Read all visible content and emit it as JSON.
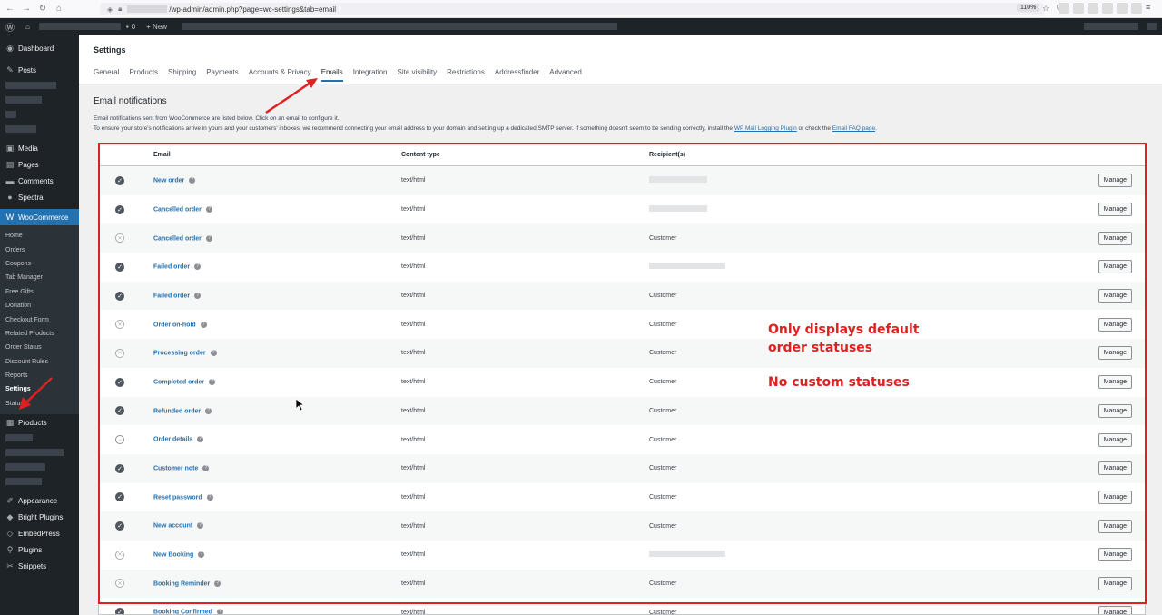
{
  "browser": {
    "url_prefix": "/wp-admin/admin.php?page=wc-settings&tab=email",
    "zoom": "110%"
  },
  "admin_bar": {
    "comments_count": "0",
    "new_label": "+ New"
  },
  "sidebar": {
    "dashboard": "Dashboard",
    "posts": "Posts",
    "media": "Media",
    "pages": "Pages",
    "comments": "Comments",
    "spectra": "Spectra",
    "woocommerce": "WooCommerce",
    "sub": [
      "Home",
      "Orders",
      "Coupons",
      "Tab Manager",
      "Free Gifts",
      "Donation",
      "Checkout Form",
      "Related Products",
      "Order Status",
      "Discount Rules",
      "Reports",
      "Settings",
      "Status"
    ],
    "products": "Products",
    "appearance": "Appearance",
    "bright_plugins": "Bright Plugins",
    "embedpress": "EmbedPress",
    "plugins": "Plugins",
    "snippets": "Snippets"
  },
  "header": {
    "title": "Settings",
    "tabs": [
      "General",
      "Products",
      "Shipping",
      "Payments",
      "Accounts & Privacy",
      "Emails",
      "Integration",
      "Site visibility",
      "Restrictions",
      "Addressfinder",
      "Advanced"
    ],
    "active_tab": "Emails"
  },
  "section": {
    "title": "Email notifications",
    "desc1": "Email notifications sent from WooCommerce are listed below. Click on an email to configure it.",
    "desc2_a": "To ensure your store's notifications arrive in yours and your customers' inboxes, we recommend connecting your email address to your domain and setting up a dedicated SMTP server. If something doesn't seem to be sending correctly, install the ",
    "desc2_link1": "WP Mail Logging Plugin",
    "desc2_b": " or check the ",
    "desc2_link2": "Email FAQ page",
    "desc2_c": "."
  },
  "table": {
    "headers": {
      "email": "Email",
      "content_type": "Content type",
      "recipients": "Recipient(s)"
    },
    "manage_label": "Manage",
    "rows": [
      {
        "status": "enabled",
        "name": "New order",
        "type": "text/html",
        "recipient": "",
        "blurred": 64
      },
      {
        "status": "enabled",
        "name": "Cancelled order",
        "type": "text/html",
        "recipient": "",
        "blurred": 64
      },
      {
        "status": "disabled",
        "name": "Cancelled order",
        "type": "text/html",
        "recipient": "Customer"
      },
      {
        "status": "enabled",
        "name": "Failed order",
        "type": "text/html",
        "recipient": "",
        "blurred": 84
      },
      {
        "status": "enabled",
        "name": "Failed order",
        "type": "text/html",
        "recipient": "Customer"
      },
      {
        "status": "disabled",
        "name": "Order on-hold",
        "type": "text/html",
        "recipient": "Customer"
      },
      {
        "status": "disabled",
        "name": "Processing order",
        "type": "text/html",
        "recipient": "Customer"
      },
      {
        "status": "enabled",
        "name": "Completed order",
        "type": "text/html",
        "recipient": "Customer"
      },
      {
        "status": "enabled",
        "name": "Refunded order",
        "type": "text/html",
        "recipient": "Customer"
      },
      {
        "status": "manual",
        "name": "Order details",
        "type": "text/html",
        "recipient": "Customer"
      },
      {
        "status": "enabled",
        "name": "Customer note",
        "type": "text/html",
        "recipient": "Customer"
      },
      {
        "status": "enabled",
        "name": "Reset password",
        "type": "text/html",
        "recipient": "Customer"
      },
      {
        "status": "enabled",
        "name": "New account",
        "type": "text/html",
        "recipient": "Customer"
      },
      {
        "status": "disabled",
        "name": "New Booking",
        "type": "text/html",
        "recipient": "",
        "blurred": 84
      },
      {
        "status": "disabled",
        "name": "Booking Reminder",
        "type": "text/html",
        "recipient": "Customer"
      },
      {
        "status": "enabled",
        "name": "Booking Confirmed",
        "type": "text/html",
        "recipient": "Customer"
      }
    ]
  },
  "annotation": {
    "line1": "Only displays default",
    "line2": "order statuses",
    "line3": "No custom statuses",
    "color": "#e02020"
  }
}
